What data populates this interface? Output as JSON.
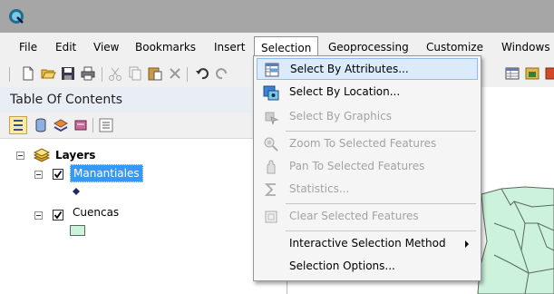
{
  "menubar": {
    "items": [
      "File",
      "Edit",
      "View",
      "Bookmarks",
      "Insert",
      "Selection",
      "Geoprocessing",
      "Customize",
      "Windows"
    ],
    "active": "Selection"
  },
  "toc": {
    "title": "Table Of Contents",
    "root_label": "Layers",
    "layers": [
      {
        "name": "Manantiales",
        "checked": true,
        "selected": true,
        "symbol": "point"
      },
      {
        "name": "Cuencas",
        "checked": true,
        "selected": false,
        "symbol": "polygon"
      }
    ]
  },
  "selection_menu": {
    "items": [
      {
        "label": "Select By Attributes...",
        "icon": "select-by-attributes-icon",
        "enabled": true,
        "highlighted": true
      },
      {
        "label": "Select By Location...",
        "icon": "select-by-location-icon",
        "enabled": true
      },
      {
        "label": "Select By Graphics",
        "icon": "select-by-graphics-icon",
        "enabled": false
      },
      {
        "label": "Zoom To Selected Features",
        "icon": "zoom-to-selected-icon",
        "enabled": false
      },
      {
        "label": "Pan To Selected Features",
        "icon": "pan-to-selected-icon",
        "enabled": false
      },
      {
        "label": "Statistics...",
        "icon": "statistics-sigma-icon",
        "enabled": false
      },
      {
        "label": "Clear Selected Features",
        "icon": "clear-selected-icon",
        "enabled": false
      },
      {
        "label": "Interactive Selection Method",
        "icon": "",
        "enabled": true,
        "submenu": true
      },
      {
        "label": "Selection Options...",
        "icon": "",
        "enabled": true
      }
    ]
  },
  "colors": {
    "menu_highlight": "#dcebfb",
    "layer_selected_bg": "#3399ff",
    "map_polygon_fill": "#ccf2dc",
    "map_polygon_outline": "#5a6b5a",
    "point_symbol": "#1f2a6b"
  }
}
